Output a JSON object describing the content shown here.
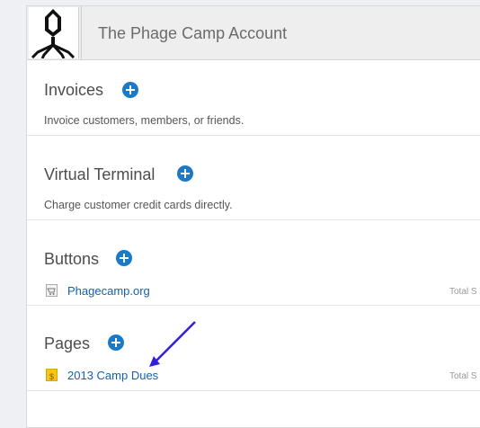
{
  "header": {
    "title": "The Phage Camp Account",
    "logo_icon": "phage-virus-logo"
  },
  "sections": {
    "invoices": {
      "title": "Invoices",
      "description": "Invoice customers, members, or friends."
    },
    "virtual_terminal": {
      "title": "Virtual Terminal",
      "description": "Charge customer credit cards directly."
    },
    "buttons": {
      "title": "Buttons",
      "items": [
        {
          "label": "Phagecamp.org",
          "meta": "Total S",
          "icon": "cart-icon"
        }
      ]
    },
    "pages": {
      "title": "Pages",
      "items": [
        {
          "label": "2013 Camp Dues",
          "meta": "Total S",
          "icon": "page-dollar-icon"
        }
      ]
    }
  },
  "colors": {
    "accent": "#1a7ac7",
    "link": "#1460b0",
    "page_icon": "#f5c517",
    "annotation_arrow": "#2f1fe0"
  }
}
